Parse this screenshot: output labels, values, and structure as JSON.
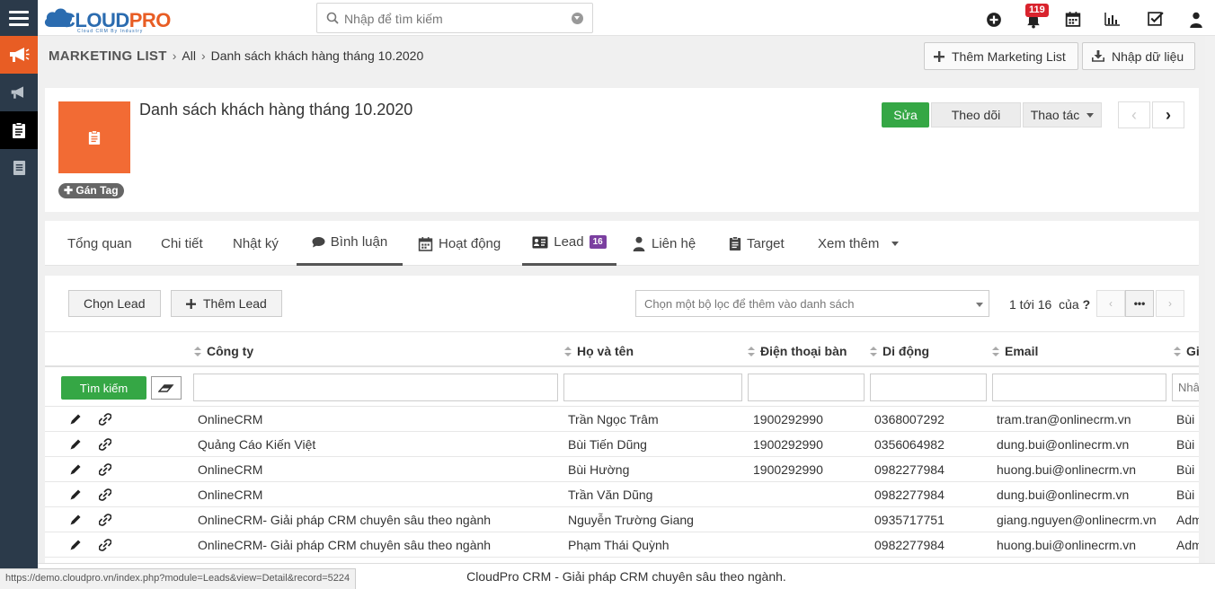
{
  "app": {
    "logo_main": "CLOUD",
    "logo_accent": "PRO",
    "logo_tagline": "Cloud CRM By Industry",
    "search_placeholder": "Nhập để tìm kiếm",
    "notification_count": "119"
  },
  "breadcrumb": {
    "module": "MARKETING LIST",
    "level1": "All",
    "level2": "Danh sách khách hàng tháng 10.2020"
  },
  "header_actions": {
    "add_list": "Thêm Marketing List",
    "import": "Nhập dữ liệu"
  },
  "record": {
    "title": "Danh sách khách hàng tháng 10.2020",
    "tag_button": "Gán Tag",
    "edit": "Sửa",
    "follow": "Theo dõi",
    "actions": "Thao tác"
  },
  "tabs": [
    {
      "label": "Tổng quan"
    },
    {
      "label": "Chi tiết"
    },
    {
      "label": "Nhật ký"
    },
    {
      "label": "Bình luận"
    },
    {
      "label": "Hoạt động"
    },
    {
      "label": "Lead",
      "badge": "16"
    },
    {
      "label": "Liên hệ"
    },
    {
      "label": "Target"
    },
    {
      "label": "Xem thêm"
    }
  ],
  "list": {
    "select_lead": "Chọn Lead",
    "add_lead": "Thêm Lead",
    "filter_placeholder": "Chọn một bộ lọc để thêm vào danh sách",
    "pager_range": "1 tới 16",
    "pager_of": "của",
    "pager_total": "?",
    "pager_more": "•••",
    "search_button": "Tìm kiếm",
    "columns": [
      "Công ty",
      "Họ và tên",
      "Điện thoại bàn",
      "Di động",
      "Email",
      "Gi"
    ],
    "last_filter_placeholder": "Nhâ",
    "rows": [
      {
        "company": "OnlineCRM",
        "name": "Trần Ngọc Trâm",
        "phone": "1900292990",
        "mobile": "0368007292",
        "email": "tram.tran@onlinecrm.vn",
        "owner": "Bùi"
      },
      {
        "company": "Quảng Cáo Kiến Việt",
        "name": "Bùi Tiến Dũng",
        "phone": "1900292990",
        "mobile": "0356064982",
        "email": "dung.bui@onlinecrm.vn",
        "owner": "Bùi"
      },
      {
        "company": "OnlineCRM",
        "name": "Bùi Hường",
        "phone": "1900292990",
        "mobile": "0982277984",
        "email": "huong.bui@onlinecrm.vn",
        "owner": "Bùi"
      },
      {
        "company": "OnlineCRM",
        "name": "Trần Văn Dũng",
        "phone": "",
        "mobile": "0982277984",
        "email": "dung.bui@onlinecrm.vn",
        "owner": "Bùi"
      },
      {
        "company": "OnlineCRM- Giải pháp CRM chuyên sâu theo ngành",
        "name": "Nguyễn Trường Giang",
        "phone": "",
        "mobile": "0935717751",
        "email": "giang.nguyen@onlinecrm.vn",
        "owner": "Adm"
      },
      {
        "company": "OnlineCRM- Giải pháp CRM chuyên sâu theo ngành",
        "name": "Phạm Thái Quỳnh",
        "phone": "",
        "mobile": "0982277984",
        "email": "huong.bui@onlinecrm.vn",
        "owner": "Adm"
      }
    ]
  },
  "footer": {
    "text": "CloudPro CRM - Giải pháp CRM chuyên sâu theo ngành.",
    "status_url": "https://demo.cloudpro.vn/index.php?module=Leads&view=Detail&record=5224"
  },
  "colors": {
    "sidebar": "#2b3a4a",
    "accent_orange": "#e85d24",
    "success_green": "#35a745",
    "badge_purple": "#7b3fa0",
    "notify_red": "#d9232d"
  }
}
